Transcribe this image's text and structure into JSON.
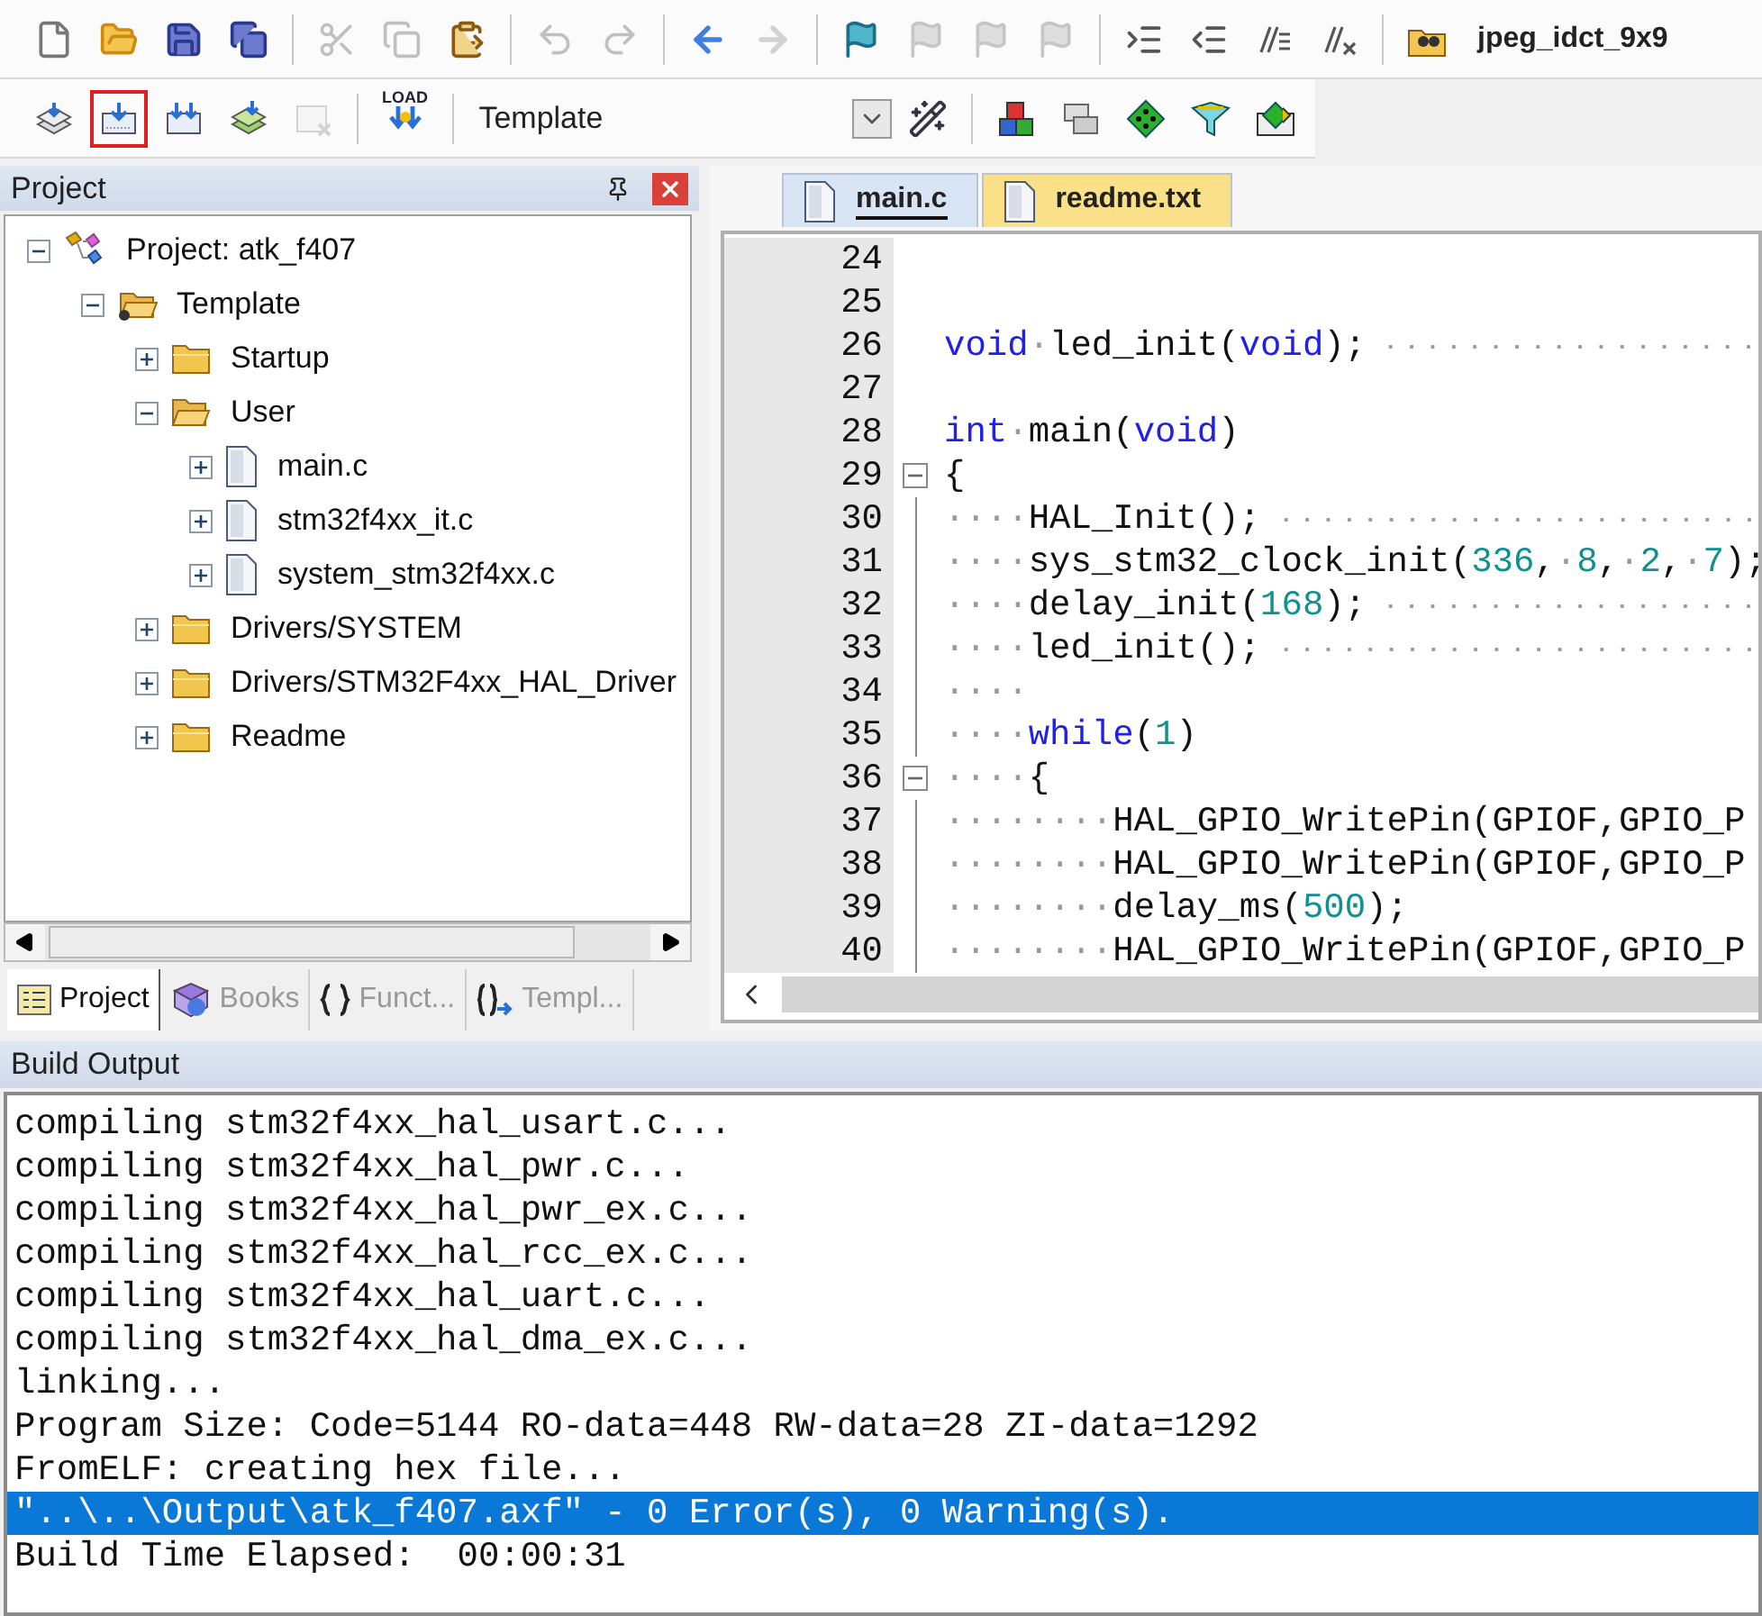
{
  "toolbar_1": {
    "buttons": [
      {
        "kind": "new",
        "disabled": false
      },
      {
        "kind": "open",
        "disabled": false
      },
      {
        "kind": "save",
        "disabled": false
      },
      {
        "kind": "save-all",
        "disabled": false
      },
      {
        "kind": "sep"
      },
      {
        "kind": "cut",
        "disabled": true
      },
      {
        "kind": "copy",
        "disabled": true
      },
      {
        "kind": "paste",
        "disabled": false
      },
      {
        "kind": "sep"
      },
      {
        "kind": "undo",
        "disabled": true
      },
      {
        "kind": "redo",
        "disabled": true
      },
      {
        "kind": "sep"
      },
      {
        "kind": "back",
        "disabled": false
      },
      {
        "kind": "forward",
        "disabled": true
      },
      {
        "kind": "sep"
      },
      {
        "kind": "bookmark",
        "disabled": false
      },
      {
        "kind": "bookmark-prev",
        "disabled": true
      },
      {
        "kind": "bookmark-next",
        "disabled": true
      },
      {
        "kind": "bookmark-clear",
        "disabled": true
      },
      {
        "kind": "sep"
      },
      {
        "kind": "indent",
        "disabled": false
      },
      {
        "kind": "unindent",
        "disabled": false
      },
      {
        "kind": "comment",
        "disabled": false
      },
      {
        "kind": "uncomment",
        "disabled": false
      },
      {
        "kind": "sep"
      },
      {
        "kind": "find-in-files",
        "disabled": false
      }
    ],
    "search_text": "jpeg_idct_9x9"
  },
  "toolbar_2": {
    "buttons": [
      {
        "kind": "translate",
        "disabled": false,
        "highlighted": false
      },
      {
        "kind": "build",
        "disabled": false,
        "highlighted": true
      },
      {
        "kind": "rebuild",
        "disabled": false,
        "highlighted": false
      },
      {
        "kind": "batch",
        "disabled": false,
        "highlighted": false
      },
      {
        "kind": "stop",
        "disabled": true,
        "highlighted": false
      }
    ],
    "load_label": "LOAD",
    "target": "Template",
    "tools": [
      {
        "kind": "wand"
      },
      {
        "kind": "components"
      },
      {
        "kind": "environment"
      },
      {
        "kind": "books"
      },
      {
        "kind": "pack"
      },
      {
        "kind": "packs"
      }
    ]
  },
  "project_panel": {
    "title": "Project",
    "tree": [
      {
        "label": "Project: atk_f407",
        "kind": "project",
        "expanded": true,
        "children": [
          {
            "label": "Template",
            "kind": "target",
            "expanded": true,
            "children": [
              {
                "label": "Startup",
                "kind": "group",
                "expanded": false
              },
              {
                "label": "User",
                "kind": "group",
                "expanded": true,
                "children": [
                  {
                    "label": "main.c",
                    "kind": "file",
                    "expanded": false
                  },
                  {
                    "label": "stm32f4xx_it.c",
                    "kind": "file",
                    "expanded": false
                  },
                  {
                    "label": "system_stm32f4xx.c",
                    "kind": "file",
                    "expanded": false
                  }
                ]
              },
              {
                "label": "Drivers/SYSTEM",
                "kind": "group",
                "expanded": false
              },
              {
                "label": "Drivers/STM32F4xx_HAL_Driver",
                "kind": "group",
                "expanded": false
              },
              {
                "label": "Readme",
                "kind": "group",
                "expanded": false
              }
            ]
          }
        ]
      }
    ],
    "tabs": [
      {
        "label": "Project",
        "kind": "project",
        "selected": true
      },
      {
        "label": "Books",
        "kind": "books",
        "selected": false
      },
      {
        "label": "Funct...",
        "kind": "functions",
        "selected": false
      },
      {
        "label": "Templ...",
        "kind": "templates",
        "selected": false
      }
    ]
  },
  "editor": {
    "tabs": [
      {
        "label": "main.c",
        "selected": true
      },
      {
        "label": "readme.txt",
        "selected": false
      }
    ],
    "lines": [
      {
        "number": "24"
      },
      {
        "number": "25"
      },
      {
        "number": "26",
        "trail": true,
        "tokens": [
          {
            "t": "void",
            "kind": "kw"
          },
          {
            "t": "·",
            "kind": "ws"
          },
          {
            "t": "led_init(",
            "kind": "id"
          },
          {
            "t": "void",
            "kind": "kw"
          },
          {
            "t": ");",
            "kind": "id"
          }
        ]
      },
      {
        "number": "27"
      },
      {
        "number": "28",
        "tokens": [
          {
            "t": "int",
            "kind": "kw"
          },
          {
            "t": "·",
            "kind": "ws"
          },
          {
            "t": "main(",
            "kind": "id"
          },
          {
            "t": "void",
            "kind": "kw"
          },
          {
            "t": ")",
            "kind": "id"
          }
        ]
      },
      {
        "number": "29",
        "fold_start": true,
        "tokens": [
          {
            "t": "{",
            "kind": "id"
          }
        ]
      },
      {
        "number": "30",
        "fold_body": true,
        "trail": true,
        "tokens": [
          {
            "t": "····",
            "kind": "ws"
          },
          {
            "t": "HAL_Init();",
            "kind": "id"
          }
        ]
      },
      {
        "number": "31",
        "fold_body": true,
        "tokens": [
          {
            "t": "····",
            "kind": "ws"
          },
          {
            "t": "sys_stm32_clock_init(",
            "kind": "id"
          },
          {
            "t": "336",
            "kind": "num"
          },
          {
            "t": ",",
            "kind": "id"
          },
          {
            "t": "·",
            "kind": "ws"
          },
          {
            "t": "8",
            "kind": "num"
          },
          {
            "t": ",",
            "kind": "id"
          },
          {
            "t": "·",
            "kind": "ws"
          },
          {
            "t": "2",
            "kind": "num"
          },
          {
            "t": ",",
            "kind": "id"
          },
          {
            "t": "·",
            "kind": "ws"
          },
          {
            "t": "7",
            "kind": "num"
          },
          {
            "t": ");",
            "kind": "id"
          }
        ]
      },
      {
        "number": "32",
        "fold_body": true,
        "trail": true,
        "tokens": [
          {
            "t": "····",
            "kind": "ws"
          },
          {
            "t": "delay_init(",
            "kind": "id"
          },
          {
            "t": "168",
            "kind": "num"
          },
          {
            "t": ");",
            "kind": "id"
          }
        ]
      },
      {
        "number": "33",
        "fold_body": true,
        "trail": true,
        "tokens": [
          {
            "t": "····",
            "kind": "ws"
          },
          {
            "t": "led_init();",
            "kind": "id"
          }
        ]
      },
      {
        "number": "34",
        "fold_body": true,
        "tokens": [
          {
            "t": "····",
            "kind": "ws"
          }
        ]
      },
      {
        "number": "35",
        "fold_body": true,
        "tokens": [
          {
            "t": "····",
            "kind": "ws"
          },
          {
            "t": "while",
            "kind": "kw"
          },
          {
            "t": "(",
            "kind": "id"
          },
          {
            "t": "1",
            "kind": "num"
          },
          {
            "t": ")",
            "kind": "id"
          }
        ]
      },
      {
        "number": "36",
        "fold_start": true,
        "tokens": [
          {
            "t": "····",
            "kind": "ws"
          },
          {
            "t": "{",
            "kind": "id"
          }
        ]
      },
      {
        "number": "37",
        "fold_body": true,
        "tokens": [
          {
            "t": "········",
            "kind": "ws"
          },
          {
            "t": "HAL_GPIO_WritePin(GPIOF,GPIO_P",
            "kind": "id"
          }
        ]
      },
      {
        "number": "38",
        "fold_body": true,
        "tokens": [
          {
            "t": "········",
            "kind": "ws"
          },
          {
            "t": "HAL_GPIO_WritePin(GPIOF,GPIO_P",
            "kind": "id"
          }
        ]
      },
      {
        "number": "39",
        "fold_body": true,
        "tokens": [
          {
            "t": "········",
            "kind": "ws"
          },
          {
            "t": "delay_ms(",
            "kind": "id"
          },
          {
            "t": "500",
            "kind": "num"
          },
          {
            "t": ");",
            "kind": "id"
          }
        ]
      },
      {
        "number": "40",
        "fold_body": true,
        "tokens": [
          {
            "t": "········",
            "kind": "ws"
          },
          {
            "t": "HAL_GPIO_WritePin(GPIOF,GPIO_P",
            "kind": "id"
          }
        ]
      }
    ]
  },
  "build_output": {
    "title": "Build Output",
    "lines": [
      {
        "text": "compiling stm32f4xx_hal_usart.c...",
        "selected": false
      },
      {
        "text": "compiling stm32f4xx_hal_pwr.c...",
        "selected": false
      },
      {
        "text": "compiling stm32f4xx_hal_pwr_ex.c...",
        "selected": false
      },
      {
        "text": "compiling stm32f4xx_hal_rcc_ex.c...",
        "selected": false
      },
      {
        "text": "compiling stm32f4xx_hal_uart.c...",
        "selected": false
      },
      {
        "text": "compiling stm32f4xx_hal_dma_ex.c...",
        "selected": false
      },
      {
        "text": "linking...",
        "selected": false
      },
      {
        "text": "Program Size: Code=5144 RO-data=448 RW-data=28 ZI-data=1292",
        "selected": false
      },
      {
        "text": "FromELF: creating hex file...",
        "selected": false
      },
      {
        "text": "\"..\\..\\Output\\atk_f407.axf\" - 0 Error(s), 0 Warning(s).",
        "selected": true
      },
      {
        "text": "Build Time Elapsed:  00:00:31",
        "selected": false
      }
    ]
  }
}
